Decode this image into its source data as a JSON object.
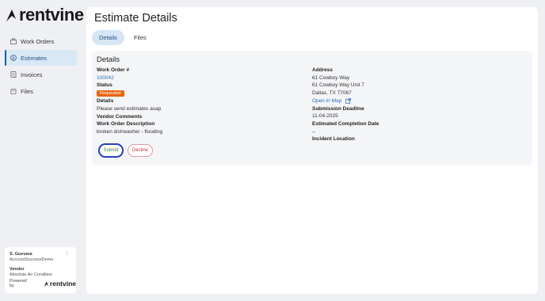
{
  "brand": {
    "name": "rentvine"
  },
  "sidebar": {
    "items": [
      {
        "label": "Work Orders",
        "icon": "toolbox-icon",
        "active": false
      },
      {
        "label": "Estimates",
        "icon": "dollar-icon",
        "active": true
      },
      {
        "label": "Invoices",
        "icon": "invoice-icon",
        "active": false
      },
      {
        "label": "Files",
        "icon": "folder-icon",
        "active": false
      }
    ]
  },
  "user": {
    "name": "S. Guevara",
    "account": "AccountSuccessDemo",
    "role": "Vendor",
    "company": "Absolute Air Condition",
    "powered_by": "Powered by",
    "powered_brand": "rentvine"
  },
  "page": {
    "title": "Estimate Details",
    "tabs": [
      {
        "label": "Details",
        "active": true
      },
      {
        "label": "Files",
        "active": false
      }
    ]
  },
  "details": {
    "title": "Details",
    "left": {
      "work_order_label": "Work Order #",
      "work_order_value": "100042",
      "status_label": "Status",
      "status_value": "Requested",
      "details_label": "Details",
      "details_value": "Please send estimates asap",
      "vendor_comments_label": "Vendor Comments",
      "description_label": "Work Order Description",
      "description_value": "broken dishwasher - flooding"
    },
    "right": {
      "address_label": "Address",
      "address_line1": "61 Cowboy Way",
      "address_line2": "61 Cowboy Way Unit 7",
      "address_line3": "Dallas, TX 77067",
      "map_link": "Open in Map",
      "deadline_label": "Submission Deadline",
      "deadline_value": "11-04-2025",
      "completion_label": "Estimated Completion Date",
      "completion_value": "--",
      "incident_label": "Incident Location"
    },
    "actions": {
      "submit": "Submit",
      "decline": "Decline"
    }
  },
  "colors": {
    "accent": "#1f4f82",
    "link": "#2a6db5",
    "status_badge": "#e8650f",
    "decline": "#cc3333"
  }
}
